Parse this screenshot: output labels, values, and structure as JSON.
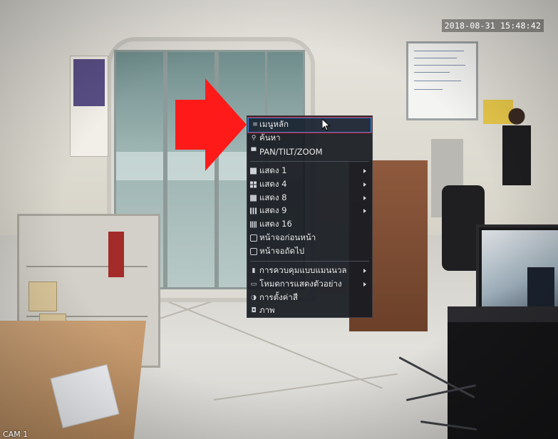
{
  "overlay": {
    "timestamp": "2018-08-31 15:48:42",
    "camera_label": "CAM 1"
  },
  "context_menu": {
    "items": [
      {
        "label": "เมนูหลัก",
        "icon": "main-menu-icon",
        "selected": true,
        "submenu": false
      },
      {
        "label": "ค้นหา",
        "icon": "search-icon",
        "selected": false,
        "submenu": false
      },
      {
        "label": "PAN/TILT/ZOOM",
        "icon": "ptz-icon",
        "selected": false,
        "submenu": false
      },
      {
        "label": "แสดง 1",
        "icon": "layout-1-icon",
        "selected": false,
        "submenu": true
      },
      {
        "label": "แสดง 4",
        "icon": "layout-4-icon",
        "selected": false,
        "submenu": true
      },
      {
        "label": "แสดง 8",
        "icon": "layout-8-icon",
        "selected": false,
        "submenu": true
      },
      {
        "label": "แสดง 9",
        "icon": "layout-9-icon",
        "selected": false,
        "submenu": true
      },
      {
        "label": "แสดง 16",
        "icon": "layout-16-icon",
        "selected": false,
        "submenu": false
      },
      {
        "label": "หน้าจอก่อนหน้า",
        "icon": "previous-screen-icon",
        "selected": false,
        "submenu": false
      },
      {
        "label": "หน้าจอถัดไป",
        "icon": "next-screen-icon",
        "selected": false,
        "submenu": false
      },
      {
        "label": "การควบคุมแบบแมนนวล",
        "icon": "manual-control-icon",
        "selected": false,
        "submenu": true
      },
      {
        "label": "โหมดการแสดงตัวอย่าง",
        "icon": "preview-mode-icon",
        "selected": false,
        "submenu": true
      },
      {
        "label": "การตั้งค่าสี",
        "icon": "color-settings-icon",
        "selected": false,
        "submenu": false
      },
      {
        "label": "ภาพ",
        "icon": "image-icon",
        "selected": false,
        "submenu": false
      }
    ]
  },
  "colors": {
    "menu_background": "#181b21",
    "selection_outline": "#2f7fe0",
    "highlight_box": "#e01e1e",
    "annotation_arrow": "#ff1a1a"
  }
}
